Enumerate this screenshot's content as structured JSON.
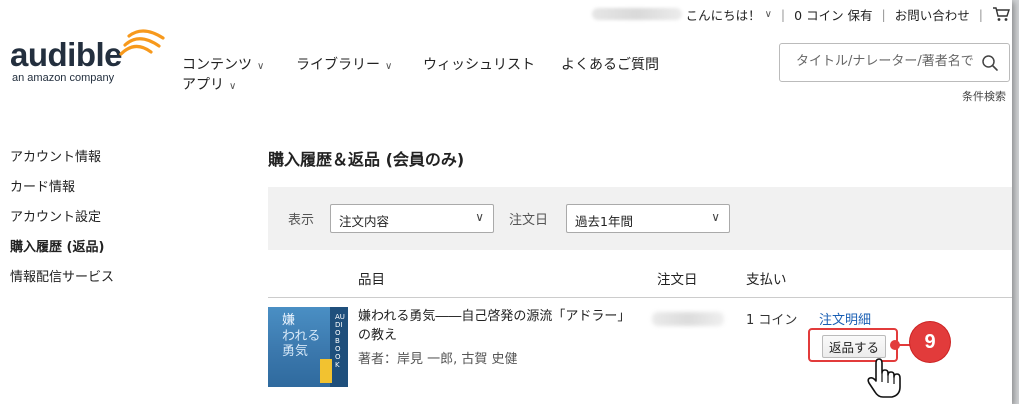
{
  "util": {
    "greeting": "こんにちは！",
    "coins": "0 コイン 保有",
    "contact": "お問い合わせ",
    "cart_icon": "cart-icon"
  },
  "logo": {
    "word": "audible",
    "sub": "an amazon company"
  },
  "nav": {
    "contents": "コンテンツ",
    "library": "ライブラリー",
    "wishlist": "ウィッシュリスト",
    "faq": "よくあるご質問",
    "app": "アプリ"
  },
  "search": {
    "placeholder": "タイトル/ナレーター/著者名で",
    "advanced": "条件検索"
  },
  "sidebar": {
    "items": [
      {
        "label": "アカウント情報"
      },
      {
        "label": "カード情報"
      },
      {
        "label": "アカウント設定"
      },
      {
        "label": "購入履歴 (返品)"
      },
      {
        "label": "情報配信サービス"
      }
    ]
  },
  "page": {
    "title": "購入履歴＆返品 (会員のみ)"
  },
  "filter": {
    "display_label": "表示",
    "display_value": "注文内容",
    "date_label": "注文日",
    "date_value": "過去1年間"
  },
  "table": {
    "headers": {
      "item": "品目",
      "date": "注文日",
      "payment": "支払い"
    },
    "rows": [
      {
        "title": "嫌われる勇気――自己啓発の源流「アドラー」の教え",
        "author": "著者：岸見 一郎, 古賀 史健",
        "payment": "1 コイン",
        "detail_link": "注文明細",
        "return_button": "返品する",
        "cover": {
          "title_a": "嫌",
          "title_b": "われる勇気",
          "spine": "AUDIO BOOK"
        }
      }
    ]
  },
  "annotation": {
    "step": "9"
  },
  "colors": {
    "accent_red": "#e23b3b",
    "link_blue": "#1a5fb4",
    "brand_orange": "#f7991c"
  }
}
